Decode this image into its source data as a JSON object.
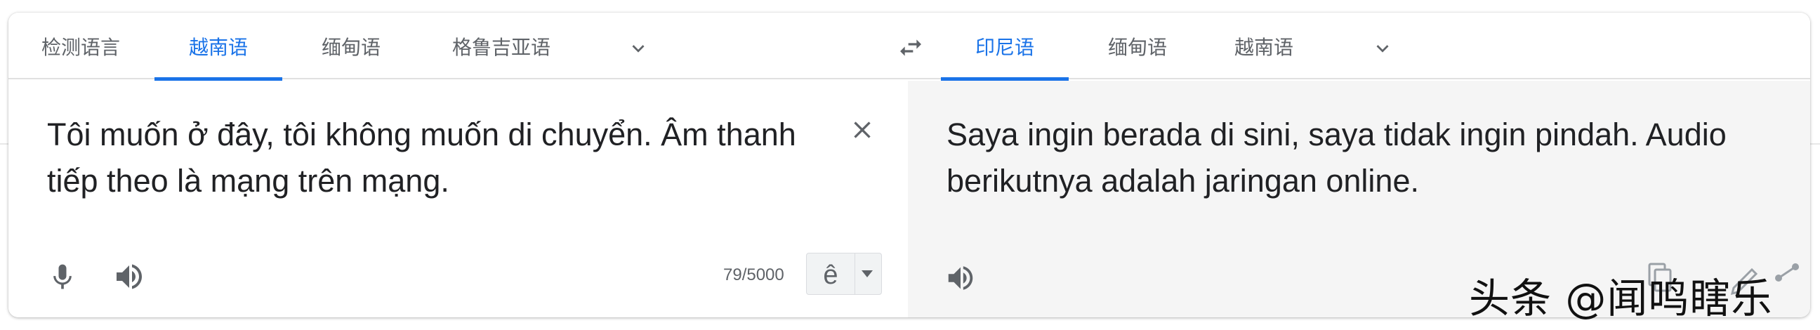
{
  "source_tabs": [
    {
      "label": "检测语言",
      "active": false
    },
    {
      "label": "越南语",
      "active": true
    },
    {
      "label": "缅甸语",
      "active": false
    },
    {
      "label": "格鲁吉亚语",
      "active": false
    }
  ],
  "target_tabs": [
    {
      "label": "印尼语",
      "active": true
    },
    {
      "label": "缅甸语",
      "active": false
    },
    {
      "label": "越南语",
      "active": false
    }
  ],
  "source": {
    "text": "Tôi muốn ở đây, tôi không muốn di chuyển. Âm thanh tiếp theo là mạng trên mạng.",
    "char_count": "79/5000",
    "ime_char": "ê"
  },
  "target": {
    "text": "Saya ingin berada di sini, saya tidak ingin pindah. Audio berikutnya adalah jaringan online."
  },
  "icons": {
    "more_languages": "chevron-down-icon",
    "swap": "swap-languages-icon",
    "clear": "close-icon",
    "mic": "microphone-icon",
    "speaker": "volume-icon",
    "copy": "copy-icon",
    "edit": "pencil-icon",
    "share": "share-icon"
  },
  "watermark": "头条 @闻鸣瞎乐",
  "colors": {
    "accent": "#1a73e8",
    "text": "#202124",
    "muted": "#5f6368",
    "target_bg": "#f5f5f5"
  }
}
